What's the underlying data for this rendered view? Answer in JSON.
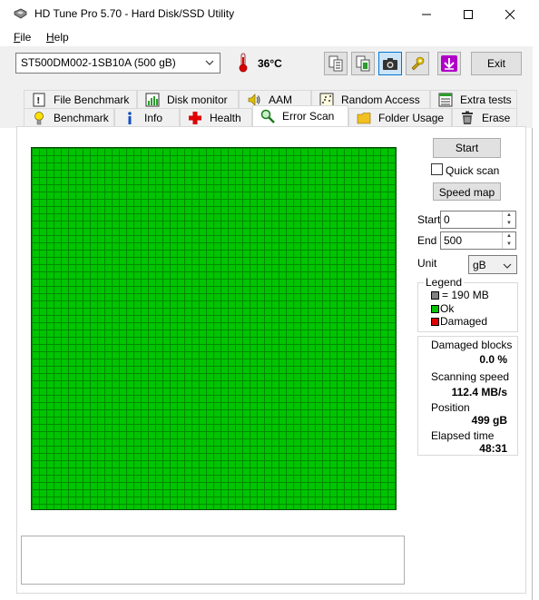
{
  "window": {
    "title": "HD Tune Pro 5.70 - Hard Disk/SSD Utility"
  },
  "menu": {
    "file_first": "F",
    "file_rest": "ile",
    "help_first": "H",
    "help_rest": "elp"
  },
  "toolbar": {
    "drive": "ST500DM002-1SB10A (500 gB)",
    "temperature": "36",
    "temperature_unit": "°C",
    "exit_label": "Exit"
  },
  "tabs": {
    "row1": [
      {
        "label": "File Benchmark"
      },
      {
        "label": "Disk monitor"
      },
      {
        "label": "AAM"
      },
      {
        "label": "Random Access"
      },
      {
        "label": "Extra tests"
      }
    ],
    "row2": [
      {
        "label": "Benchmark"
      },
      {
        "label": "Info"
      },
      {
        "label": "Health"
      },
      {
        "label": "Error Scan"
      },
      {
        "label": "Folder Usage"
      },
      {
        "label": "Erase"
      }
    ],
    "selected": "Error Scan"
  },
  "scan": {
    "start_button": "Start",
    "quick_scan_label": "Quick scan",
    "quick_scan_checked": false,
    "speed_map_button": "Speed map",
    "start_label": "Start",
    "start_value": "0",
    "end_label": "End",
    "end_value": "500",
    "unit_label": "Unit",
    "unit_value": "gB"
  },
  "legend": {
    "title": "Legend",
    "items": [
      {
        "label": "= 190 MB",
        "color": "#808080"
      },
      {
        "label": "Ok",
        "color": "#00c400"
      },
      {
        "label": "Damaged",
        "color": "#e00000"
      }
    ]
  },
  "stats": {
    "damaged_blocks_label": "Damaged blocks",
    "damaged_blocks_value": "0.0 %",
    "scanning_speed_label": "Scanning speed",
    "scanning_speed_value": "112.4 MB/s",
    "position_label": "Position",
    "position_value": "499 gB",
    "elapsed_time_label": "Elapsed time",
    "elapsed_time_value": "48:31"
  },
  "grid": {
    "status": "ok",
    "color": "#00c400"
  },
  "icons": {
    "app": "hdtune-app-icon",
    "temperature": "thermometer-icon",
    "copy_text": "copy-text-icon",
    "copy_all": "copy-all-icon",
    "screenshot": "camera-icon",
    "options": "options-icon",
    "save": "save-arrow-icon"
  }
}
